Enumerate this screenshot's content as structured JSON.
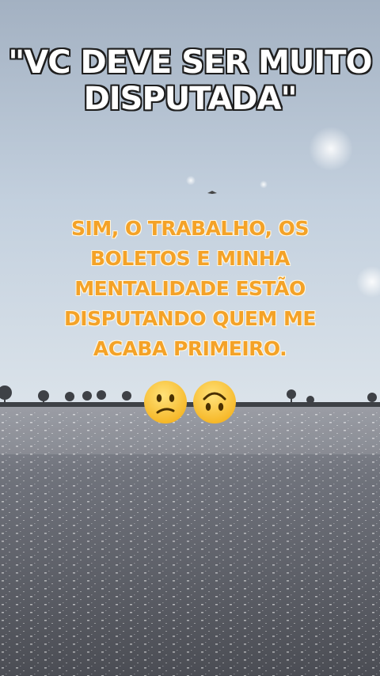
{
  "title": {
    "line1": "\"VC DEVE SER MUITO",
    "line2": "DISPUTADA\""
  },
  "answer": {
    "line1": "SIM, O TRABALHO, OS",
    "line2": "BOLETOS E MINHA",
    "line3": "MENTALIDADE ESTÃO",
    "line4": "DISPUTANDO QUEM ME",
    "line5": "ACABA PRIMEIRO."
  },
  "emojis": [
    "confused-face-icon",
    "upside-down-face-icon"
  ],
  "colors": {
    "title_fill": "#ffffff",
    "title_outline": "#1e1e1e",
    "answer_fill": "#f4a227",
    "sky": "#b9c8d8",
    "water": "#5c5e66"
  }
}
